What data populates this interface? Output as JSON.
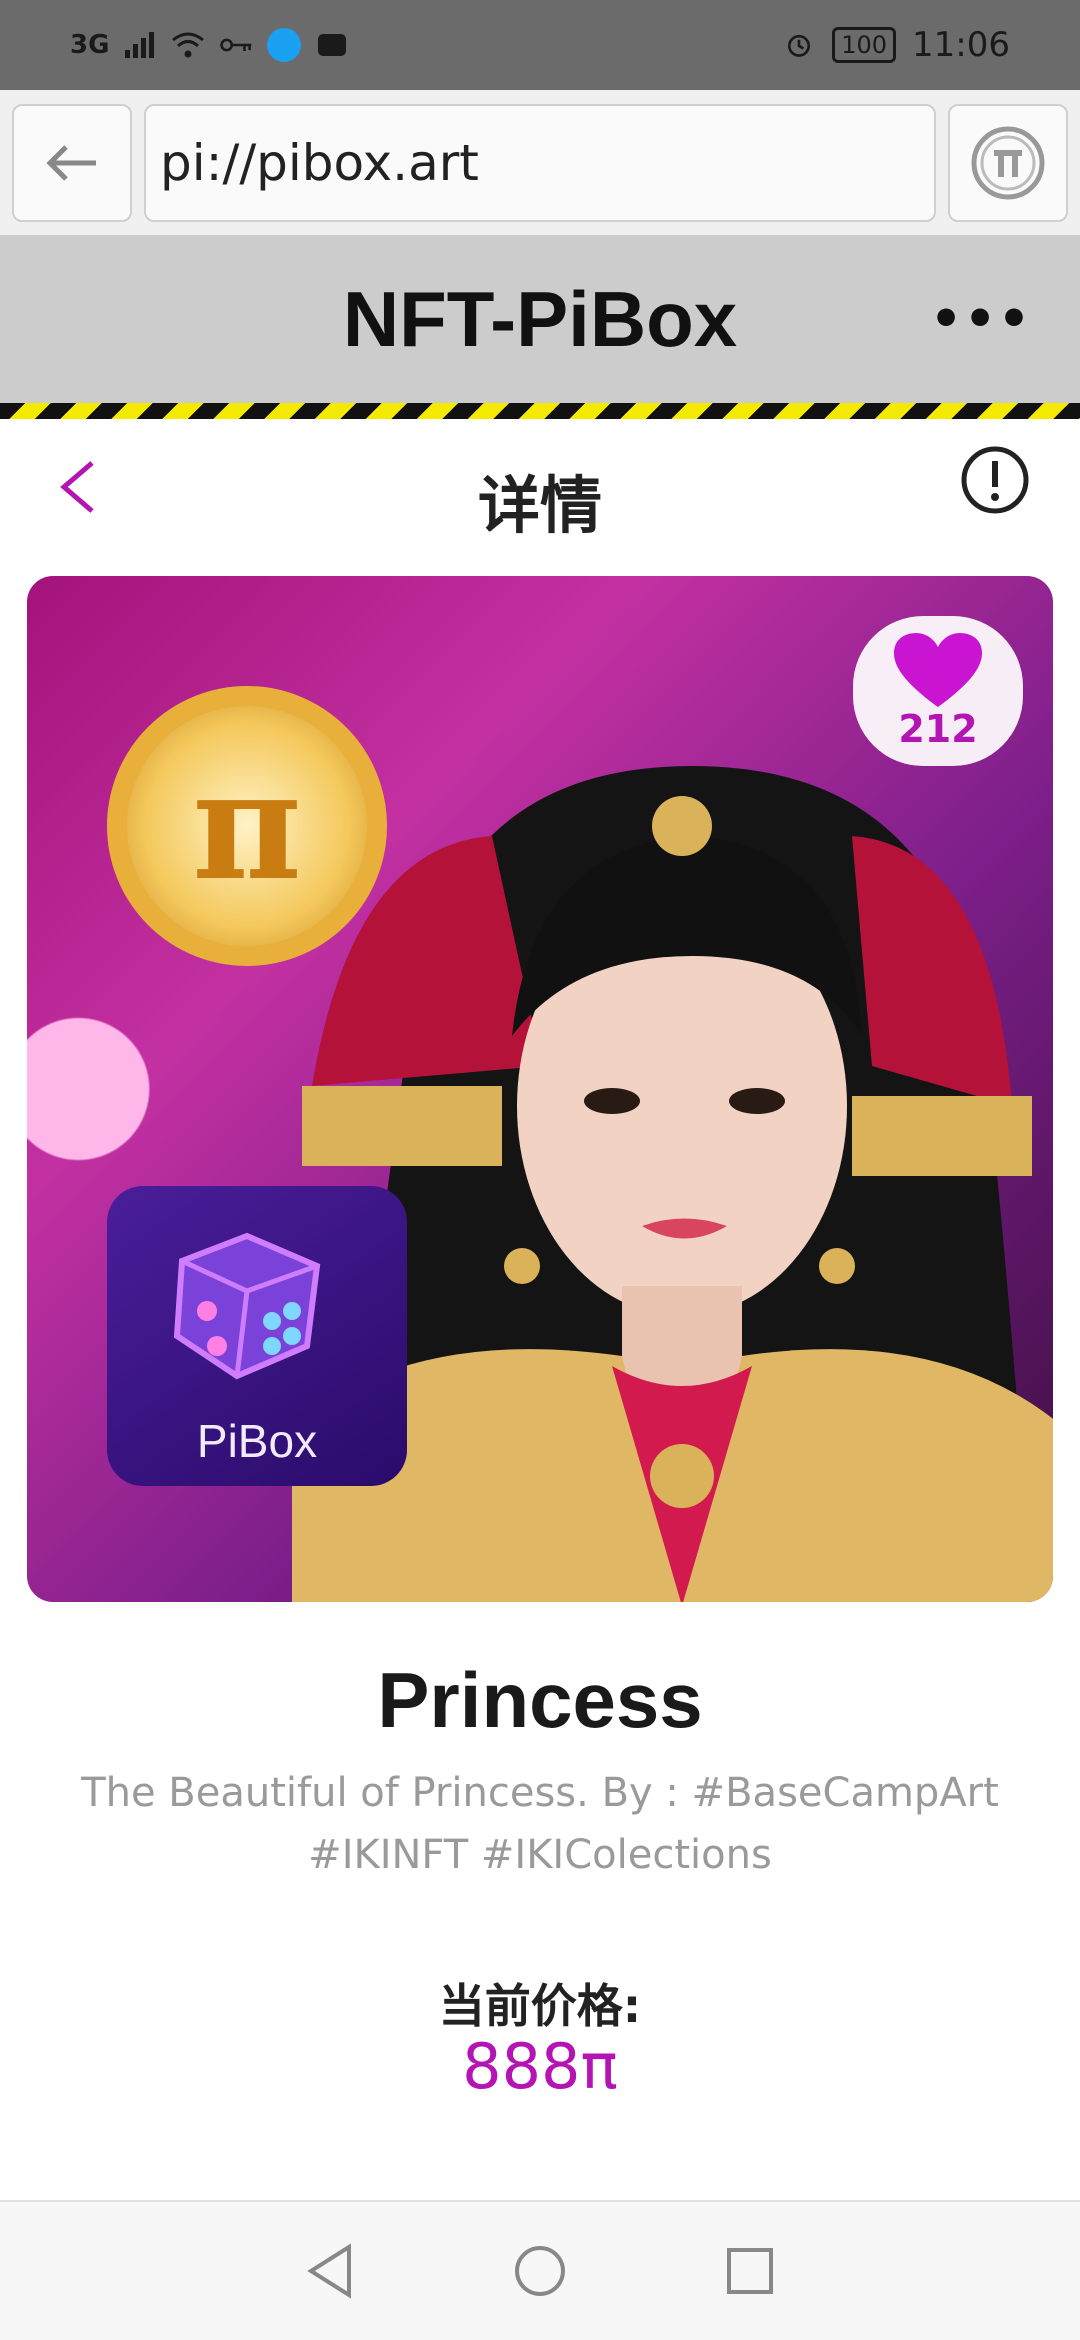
{
  "status_bar": {
    "signal_label": "3G",
    "battery": "100",
    "time": "11:06",
    "icons": [
      "signal-icon",
      "wifi-icon",
      "vpn-key-icon",
      "app-notification-icon",
      "mail-icon",
      "alarm-icon",
      "battery-icon"
    ]
  },
  "browser": {
    "url": "pi://pibox.art",
    "back_icon": "arrow-left-icon",
    "pi_icon": "pi-logo-icon"
  },
  "site": {
    "title": "NFT-PiBox",
    "more_label": "•••"
  },
  "page": {
    "title": "详情",
    "back_icon": "chevron-left-icon",
    "info_icon": "info-circle-icon"
  },
  "nft": {
    "likes": "212",
    "badge_text": "PiBox",
    "name": "Princess",
    "description": "The Beautiful of Princess. By : #BaseCampArt #IKINFT #IKIColections",
    "price_label": "当前价格:",
    "price_value": "888π"
  },
  "colors": {
    "accent": "#b414b4",
    "header_bg": "#cccccc",
    "hazard_yellow": "#f4ea00"
  }
}
